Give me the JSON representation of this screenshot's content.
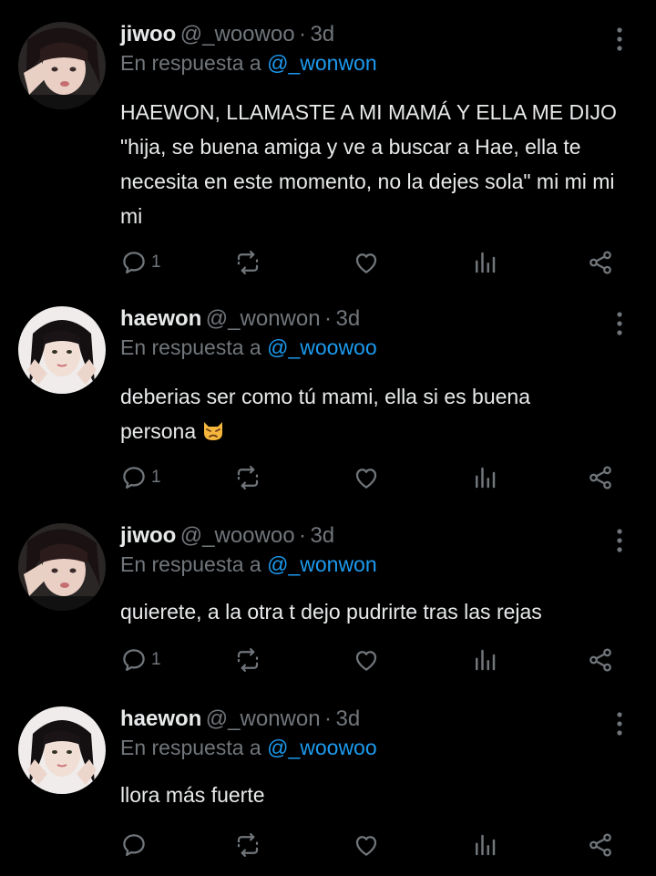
{
  "colors": {
    "background": "#000000",
    "name": "#e7e9ea",
    "muted": "#71767b",
    "link": "#1d9bf0",
    "text": "#e7e9ea"
  },
  "icons": {
    "reply": "reply-icon",
    "retweet": "retweet-icon",
    "like": "heart-icon",
    "views": "views-icon",
    "share": "share-icon",
    "more": "more-vertical-icon"
  },
  "tweets": [
    {
      "name": "jiwoo",
      "handle": "@_woowoo",
      "separator": "·",
      "time": "3d",
      "reply_prefix": "En respuesta a",
      "reply_to": "@_wonwon",
      "text": "HAEWON, LLAMASTE A MI MAMÁ Y ELLA ME DIJO \"hija, se buena amiga y ve a buscar a Hae, ella te necesita en este momento, no la dejes sola\" mi mi mi mi",
      "reply_count": "1"
    },
    {
      "name": "haewon",
      "handle": "@_wonwon",
      "separator": "·",
      "time": "3d",
      "reply_prefix": "En respuesta a",
      "reply_to": "@_woowoo",
      "text": "deberias ser como tú mami, ella si es buena persona",
      "emoji": "pouting-cat-emoji",
      "reply_count": "1"
    },
    {
      "name": "jiwoo",
      "handle": "@_woowoo",
      "separator": "·",
      "time": "3d",
      "reply_prefix": "En respuesta a",
      "reply_to": "@_wonwon",
      "text": "quierete, a la otra t dejo pudrirte tras las rejas",
      "reply_count": "1"
    },
    {
      "name": "haewon",
      "handle": "@_wonwon",
      "separator": "·",
      "time": "3d",
      "reply_prefix": "En respuesta a",
      "reply_to": "@_woowoo",
      "text": "llora más fuerte",
      "reply_count": ""
    }
  ]
}
